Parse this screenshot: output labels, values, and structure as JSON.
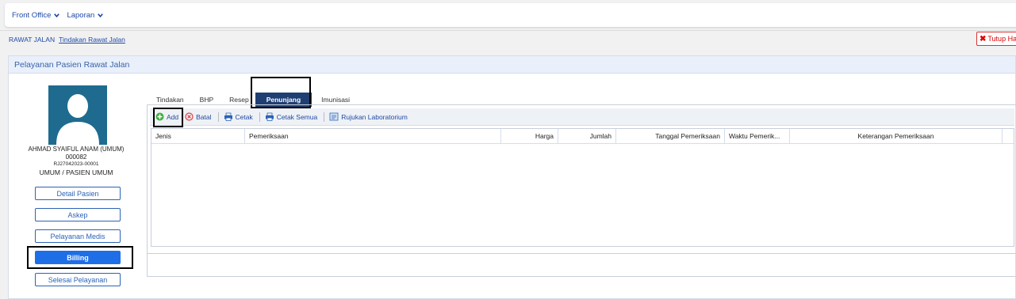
{
  "nav": {
    "items": [
      {
        "label": "Front Office"
      },
      {
        "label": "Laporan"
      }
    ]
  },
  "breadcrumb": {
    "root": "RAWAT JALAN",
    "current": "Tindakan Rawat Jalan"
  },
  "close_tab": {
    "label": "Tutup Ha"
  },
  "panel": {
    "title": "Pelayanan Pasien Rawat Jalan"
  },
  "patient": {
    "name": "AHMAD SYAIFUL ANAM (UMUM)",
    "mrn": "000082",
    "reg_no": "RJ27042023-00001",
    "payer": "UMUM / PASIEN UMUM",
    "buttons": [
      {
        "label": "Detail Pasien"
      },
      {
        "label": "Askep"
      },
      {
        "label": "Pelayanan Medis"
      },
      {
        "label": "Billing"
      },
      {
        "label": "Selesai Pelayanan"
      }
    ]
  },
  "tabs": [
    {
      "label": "Tindakan"
    },
    {
      "label": "BHP"
    },
    {
      "label": "Resep"
    },
    {
      "label": "Penunjang"
    },
    {
      "label": "Imunisasi"
    }
  ],
  "toolbar": {
    "add": "Add",
    "batal": "Batal",
    "cetak": "Cetak",
    "cetak_semua": "Cetak Semua",
    "rujukan": "Rujukan Laboratorium"
  },
  "grid": {
    "columns": [
      {
        "label": "Jenis"
      },
      {
        "label": "Pemeriksaan"
      },
      {
        "label": "Harga"
      },
      {
        "label": "Jumlah"
      },
      {
        "label": "Tanggal Pemeriksaan"
      },
      {
        "label": "Waktu Pemerik..."
      },
      {
        "label": "Keterangan Pemeriksaan"
      }
    ]
  },
  "colors": {
    "accent": "#1e6ee8",
    "tab_active": "#1f3f73",
    "link": "#1f4aa8",
    "close": "#dd0000"
  }
}
